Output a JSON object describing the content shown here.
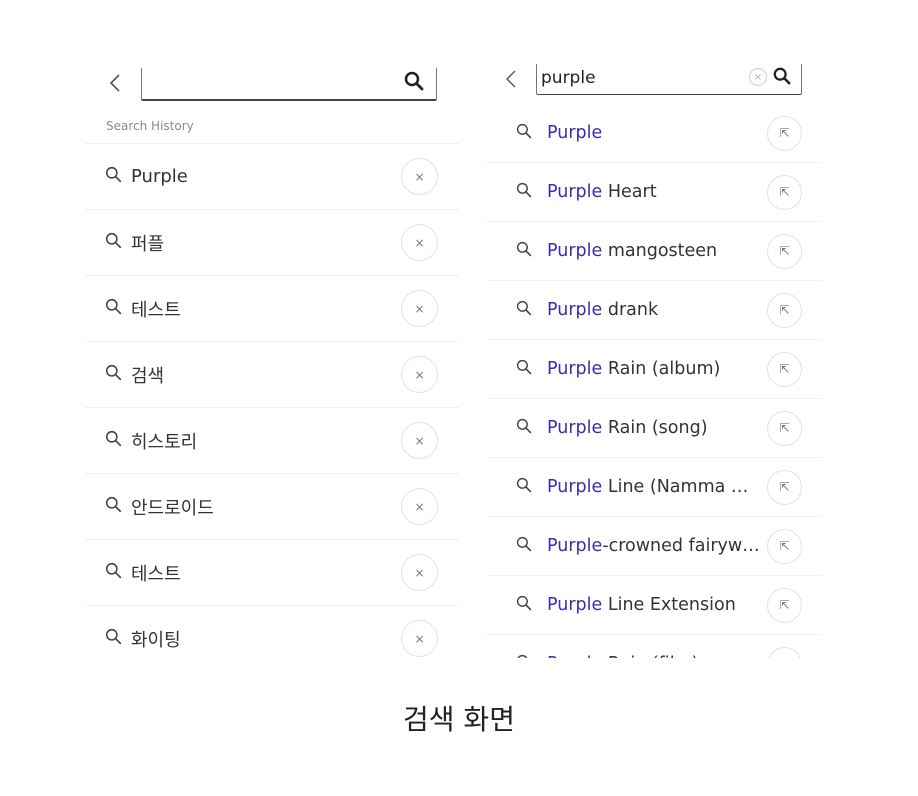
{
  "left": {
    "history_label": "Search History",
    "history": [
      {
        "label": "Purple"
      },
      {
        "label": "퍼플"
      },
      {
        "label": "테스트"
      },
      {
        "label": "검색"
      },
      {
        "label": "히스토리"
      },
      {
        "label": "안드로이드"
      },
      {
        "label": "테스트"
      },
      {
        "label": "화이팅"
      }
    ],
    "remove_glyph": "×"
  },
  "right": {
    "query": "purple",
    "clear_glyph": "×",
    "suggestions": [
      {
        "match": "Purple",
        "rest": ""
      },
      {
        "match": "Purple",
        "rest": " Heart"
      },
      {
        "match": "Purple",
        "rest": " mangosteen"
      },
      {
        "match": "Purple",
        "rest": " drank"
      },
      {
        "match": "Purple",
        "rest": " Rain (album)"
      },
      {
        "match": "Purple",
        "rest": " Rain (song)"
      },
      {
        "match": "Purple",
        "rest": " Line (Namma Met..."
      },
      {
        "match": "Purple",
        "rest": "-crowned fairywren"
      },
      {
        "match": "Purple",
        "rest": " Line Extension"
      },
      {
        "match": "Purple",
        "rest": " Rain (film)"
      }
    ],
    "insert_glyph": "⇱"
  },
  "caption": "검색 화면",
  "colors": {
    "highlight": "#3d2dad",
    "divider": "#efefef"
  }
}
